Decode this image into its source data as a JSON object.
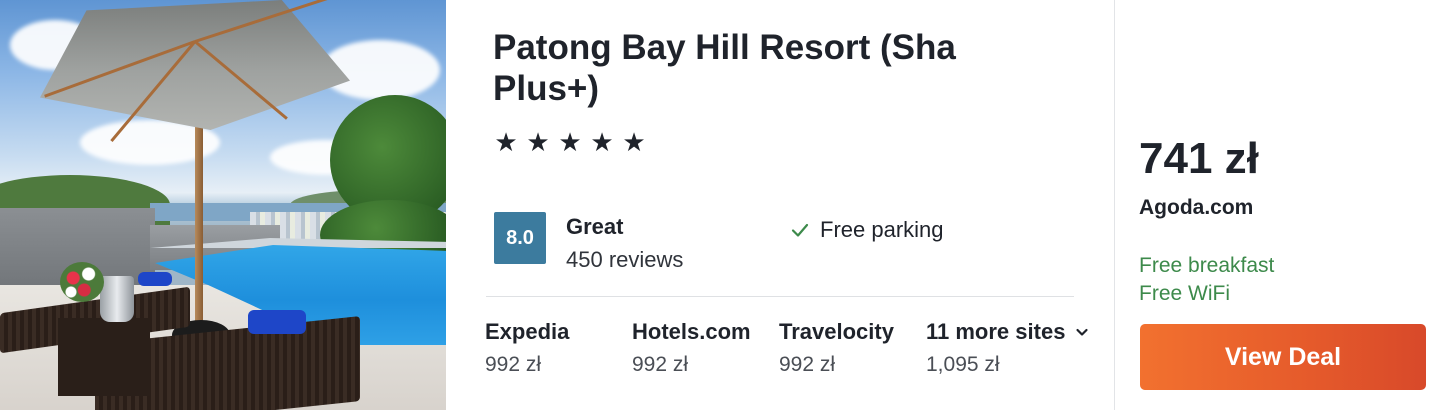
{
  "hotel": {
    "name": "Patong Bay Hill Resort (Sha Plus+)",
    "stars": [
      "★",
      "★",
      "★",
      "★",
      "★"
    ],
    "rating": {
      "score": "8.0",
      "label": "Great",
      "reviews": "450 reviews"
    },
    "amenity": "Free parking"
  },
  "sites": [
    {
      "name": "Expedia",
      "price": "992 zł"
    },
    {
      "name": "Hotels.com",
      "price": "992 zł"
    },
    {
      "name": "Travelocity",
      "price": "992 zł"
    },
    {
      "name": "11 more sites",
      "price": "1,095 zł"
    }
  ],
  "deal": {
    "price": "741 zł",
    "provider": "Agoda.com",
    "perks": [
      "Free breakfast",
      "Free WiFi"
    ],
    "button_label": "View Deal"
  },
  "colors": {
    "score_badge": "#3c7b9e",
    "perk_green": "#3d8a4b",
    "deal_button": "#e55a2b"
  },
  "icons": {
    "amenity": "check-icon",
    "more_sites": "chevron-down-icon"
  }
}
